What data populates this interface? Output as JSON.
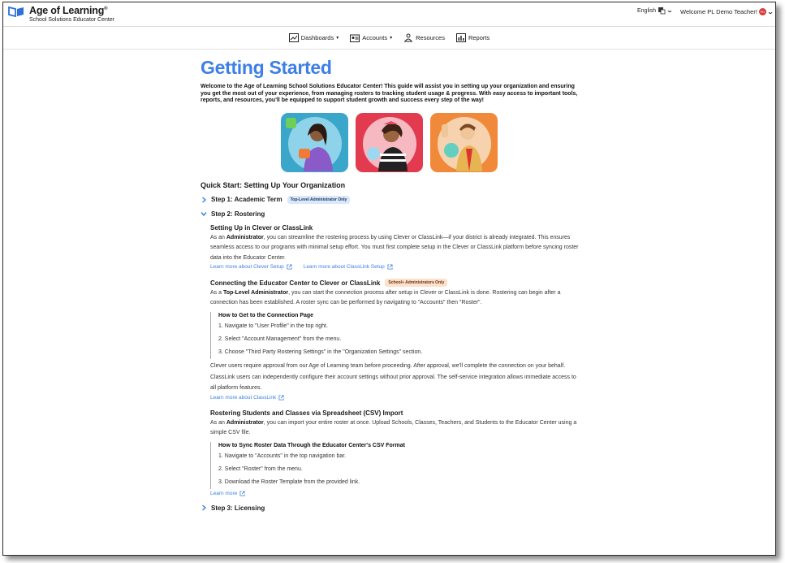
{
  "header": {
    "brand_title": "Age of Learning",
    "brand_tm": "®",
    "brand_sub": "School Solutions Educator Center",
    "language": "English",
    "welcome": "Welcome PL Demo Teacher!"
  },
  "nav": {
    "dashboards": "Dashboards",
    "accounts": "Accounts",
    "resources": "Resources",
    "reports": "Reports"
  },
  "main": {
    "title": "Getting Started",
    "intro": "Welcome to the Age of Learning School Solutions Educator Center! This guide will assist you in setting up your organization and ensuring you get the most out of your experience, from managing rosters to tracking student usage & progress. With easy access to important tools, reports, and resources, you'll be equipped to support student growth and success every step of the way!",
    "quickstart": "Quick Start: Setting Up Your Organization",
    "step1": {
      "label": "Step 1: Academic Term",
      "badge": "Top-Level Administrator Only"
    },
    "step2": {
      "label": "Step 2: Rostering"
    },
    "step3": {
      "label": "Step 3: Licensing"
    },
    "clever": {
      "heading": "Setting Up in Clever or ClassLink",
      "p1a": "As an ",
      "p1b": "Administrator",
      "p1c": ", you can streamline the rostering process by using Clever or ClassLink—if your district is already integrated. This ensures seamless access to our programs with minimal setup effort. You must first complete setup in the Clever or ClassLink platform before syncing roster data into the Educator Center.",
      "link1": "Learn more about Clever Setup",
      "link2": "Learn more about ClassLink Setup"
    },
    "connect": {
      "heading": "Connecting the Educator Center to Clever or ClassLink",
      "badge": "School+ Administrators Only",
      "p1a": "As a ",
      "p1b": "Top-Level Administrator",
      "p1c": ", you can start the connection process after setup in Clever or ClassLink is done. Rostering can begin after a connection has been established. A roster sync can be performed by navigating to \"Accounts\" then \"Roster\".",
      "howto_title": "How to Get to the Connection Page",
      "steps": [
        "1. Navigate to \"User Profile\" in the top right.",
        "2. Select \"Account Management\" from the menu.",
        "3. Choose \"Third Party Rostering Settings\" in the \"Organization Settings\" section."
      ],
      "p2": "Clever users require approval from our Age of Learning team before proceeding. After approval, we'll complete the connection on your behalf.",
      "p3": "ClassLink users can independently configure their account settings without prior approval. The self-service integration allows immediate access to all platform features.",
      "link": "Learn more about ClassLink"
    },
    "csv": {
      "heading": "Rostering Students and Classes via Spreadsheet (CSV) Import",
      "p1a": "As an ",
      "p1b": "Administrator",
      "p1c": ", you can import your entire roster at once. Upload Schools, Classes, Teachers, and Students to the Educator Center using a simple CSV file.",
      "howto_title": "How to Sync Roster Data Through the Educator Center's CSV Format",
      "steps": [
        "1. Navigate to \"Accounts\" in the top navigation bar.",
        "2. Select \"Roster\" from the menu.",
        "3. Download the Roster Template from the provided link."
      ],
      "link": "Learn more"
    }
  },
  "colors": {
    "accent": "#3d7fe6",
    "card1": "#3aa6c9",
    "card2": "#e23a4e",
    "card3": "#f08a3a"
  }
}
